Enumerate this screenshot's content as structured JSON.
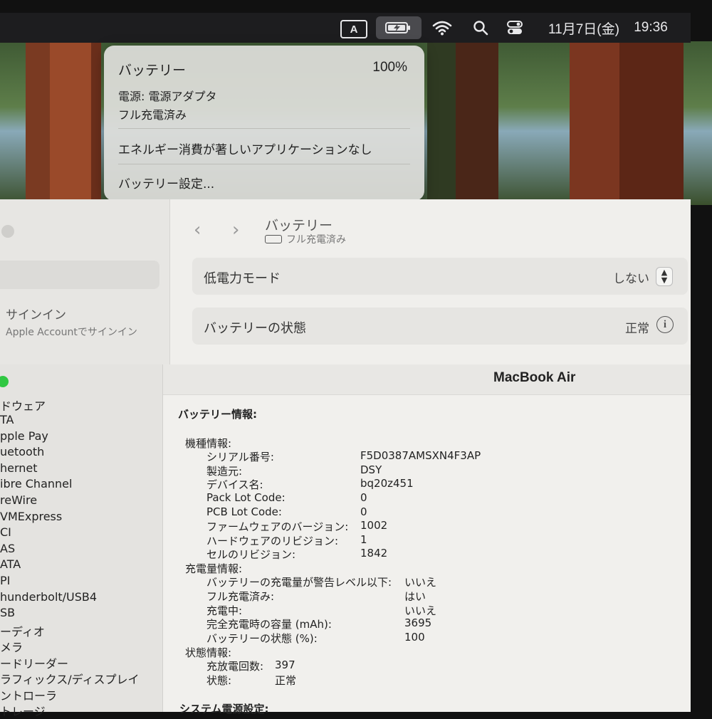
{
  "menubar": {
    "input_indicator": "A",
    "date": "11月7日(金)",
    "time": "19:36",
    "icons": [
      "battery-charging-icon",
      "wifi-icon",
      "search-icon",
      "control-center-icon"
    ]
  },
  "battery_menu": {
    "title": "バッテリー",
    "percent": "100%",
    "power_source": "電源: 電源アダプタ",
    "charge_state": "フル充電済み",
    "energy_note": "エネルギー消費が著しいアプリケーションなし",
    "settings_link": "バッテリー設定..."
  },
  "settings": {
    "nav_back": "‹",
    "nav_forward": "›",
    "pane_title": "バッテリー",
    "pane_subtitle": "フル充電済み",
    "signin_title": "サインイン",
    "signin_sub": "Apple Accountでサインイン",
    "low_power_label": "低電力モード",
    "low_power_value": "しない",
    "health_label": "バッテリーの状態",
    "health_value": "正常"
  },
  "sysinfo": {
    "window_title": "MacBook Air",
    "sidebar": [
      "ドウェア",
      "TA",
      "pple Pay",
      "uetooth",
      "hernet",
      "ibre Channel",
      "reWire",
      "VMExpress",
      "CI",
      "AS",
      "ATA",
      "PI",
      "hunderbolt/USB4",
      "SB",
      "ーディオ",
      "メラ",
      "ードリーダー",
      "ラフィックス/ディスプレイ",
      "ントローラ",
      "トレージ"
    ],
    "section_title": "バッテリー情報:",
    "model_header": "機種情報:",
    "model": [
      {
        "k": "シリアル番号:",
        "v": "F5D0387AMSXN4F3AP"
      },
      {
        "k": "製造元:",
        "v": "DSY"
      },
      {
        "k": "デバイス名:",
        "v": "bq20z451"
      },
      {
        "k": "Pack Lot Code:",
        "v": "0"
      },
      {
        "k": "PCB Lot Code:",
        "v": "0"
      },
      {
        "k": "ファームウェアのバージョン:",
        "v": "1002"
      },
      {
        "k": "ハードウェアのリビジョン:",
        "v": "1"
      },
      {
        "k": "セルのリビジョン:",
        "v": "1842"
      }
    ],
    "charge_header": "充電量情報:",
    "charge": [
      {
        "k": "バッテリーの充電量が警告レベル以下:",
        "v": "いいえ"
      },
      {
        "k": "フル充電済み:",
        "v": "はい"
      },
      {
        "k": "充電中:",
        "v": "いいえ"
      },
      {
        "k": "完全充電時の容量 (mAh):",
        "v": "3695"
      },
      {
        "k": "バッテリーの状態 (%):",
        "v": "100"
      }
    ],
    "status_header": "状態情報:",
    "status": [
      {
        "k": "充放電回数:",
        "v": "397"
      },
      {
        "k": "状態:",
        "v": "正常"
      }
    ],
    "next_section": "システム電源設定:"
  }
}
